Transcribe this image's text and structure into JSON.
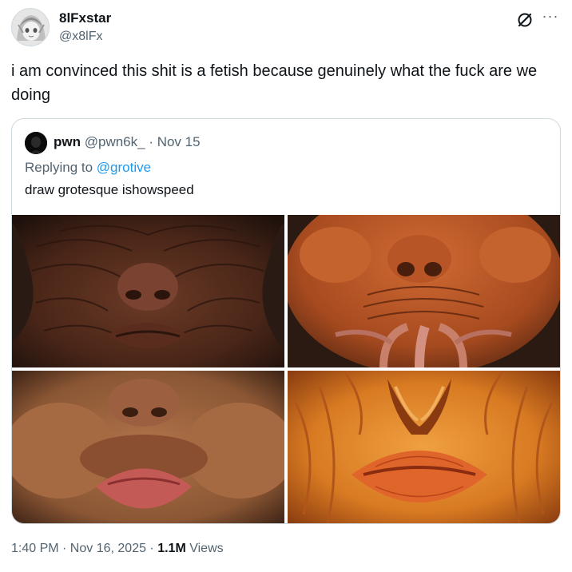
{
  "tweet": {
    "author": {
      "display_name": "8lFxstar",
      "handle": "@x8lFx"
    },
    "text": "i am convinced this shit is a fetish because genuinely what the fuck are we doing",
    "timestamp": "1:40 PM · Nov 16, 2025",
    "separator": " · ",
    "views_count": "1.1M",
    "views_label": " Views",
    "icons": {
      "grok": "grok-icon",
      "more": "more-icon"
    },
    "more_glyph": "···"
  },
  "quote": {
    "author": {
      "display_name": "pwn",
      "handle": "@pwn6k_"
    },
    "date": "Nov 15",
    "dot": " · ",
    "replying_prefix": "Replying to ",
    "replying_to": "@grotive",
    "text": "draw grotesque ishowspeed",
    "media_count": 4
  },
  "colors": {
    "text_primary": "#0f1419",
    "text_secondary": "#536471",
    "link": "#1d9bf0",
    "border": "#cfd9de"
  }
}
